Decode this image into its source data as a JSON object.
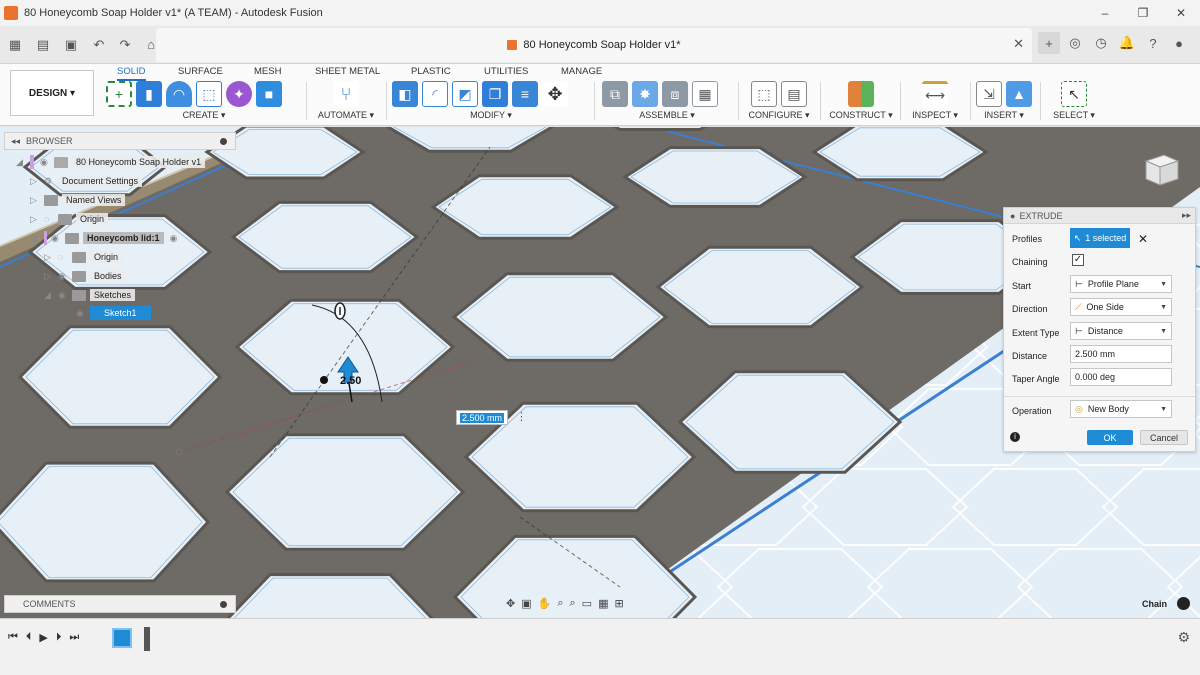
{
  "window": {
    "title": "80 Honeycomb Soap Holder v1* (A TEAM) - Autodesk Fusion",
    "controls": [
      "–",
      "❐",
      "✕"
    ]
  },
  "tabbar": {
    "doc_title": "80 Honeycomb Soap Holder v1*",
    "close": "✕"
  },
  "toolbar": {
    "workspace": "DESIGN ▾",
    "tabs": [
      "SOLID",
      "SURFACE",
      "MESH",
      "SHEET METAL",
      "PLASTIC",
      "UTILITIES",
      "MANAGE"
    ],
    "groups": [
      "CREATE ▾",
      "AUTOMATE ▾",
      "MODIFY ▾",
      "ASSEMBLE ▾",
      "CONFIGURE ▾",
      "CONSTRUCT ▾",
      "INSPECT ▾",
      "INSERT ▾",
      "SELECT ▾"
    ]
  },
  "browser": {
    "title": "BROWSER",
    "items": [
      "80 Honeycomb Soap Holder v1",
      "Document Settings",
      "Named Views",
      "Origin",
      "Honeycomb lid:1",
      "Origin",
      "Bodies",
      "Sketches",
      "Sketch1"
    ]
  },
  "viewport": {
    "dimension_label": "2.50",
    "dimension_input": "2.500 mm",
    "chain_label": "Chain"
  },
  "extrude": {
    "title": "EXTRUDE",
    "profiles_label": "Profiles",
    "profiles_value": "1 selected",
    "chaining_label": "Chaining",
    "start_label": "Start",
    "start_value": "Profile Plane",
    "direction_label": "Direction",
    "direction_value": "One Side",
    "extent_label": "Extent Type",
    "extent_value": "Distance",
    "distance_label": "Distance",
    "distance_value": "2.500 mm",
    "taper_label": "Taper Angle",
    "taper_value": "0.000 deg",
    "operation_label": "Operation",
    "operation_value": "New Body",
    "ok": "OK",
    "cancel": "Cancel"
  },
  "comments": {
    "title": "COMMENTS"
  },
  "colors": {
    "accent": "#1e8bd4",
    "frame": "#6e6a66",
    "background": "#e4eef6"
  }
}
